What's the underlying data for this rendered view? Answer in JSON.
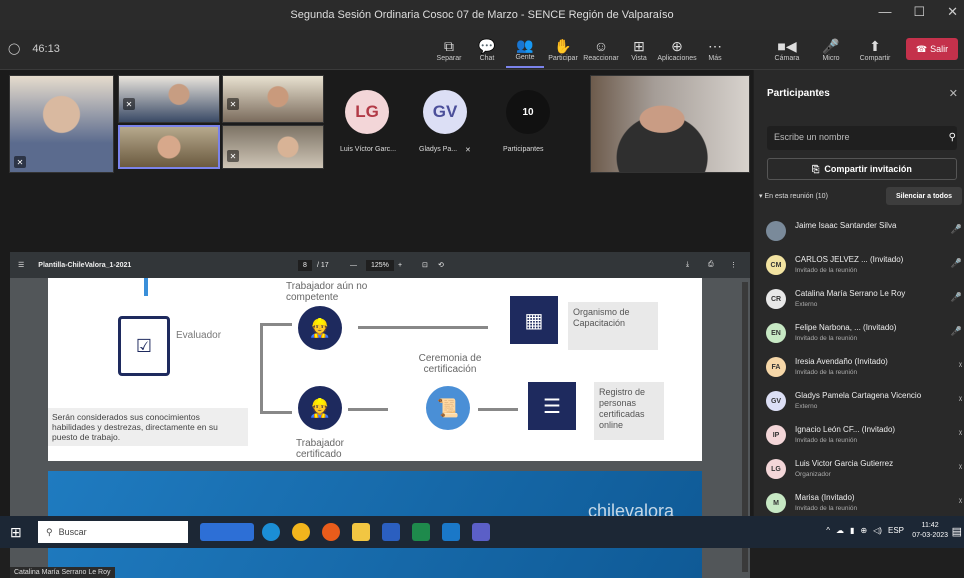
{
  "window": {
    "title": "Segunda Sesión Ordinaria Cosoc 07 de Marzo - SENCE Región de Valparaíso",
    "min": "—",
    "max": "☐",
    "close": "✕"
  },
  "toolbar": {
    "timer": "46:13",
    "items": [
      {
        "label": "Separar",
        "icon": "⧉"
      },
      {
        "label": "Chat",
        "icon": "💬"
      },
      {
        "label": "Gente",
        "icon": "👥"
      },
      {
        "label": "Participar",
        "icon": "✋"
      },
      {
        "label": "Reaccionar",
        "icon": "☺"
      },
      {
        "label": "Vista",
        "icon": "⊞"
      },
      {
        "label": "Aplicaciones",
        "icon": "⊕"
      },
      {
        "label": "Más",
        "icon": "⋯"
      }
    ],
    "right": [
      {
        "label": "Cámara",
        "icon": "■◀"
      },
      {
        "label": "Micro",
        "icon": "🎤"
      },
      {
        "label": "Compartir",
        "icon": "⬆"
      }
    ],
    "leave": "Salir"
  },
  "video": {
    "avatars": [
      {
        "initials": "LG",
        "name": "Luis Víctor Garc...",
        "color": "#f3d6d8",
        "text": "#b23a46"
      },
      {
        "initials": "GV",
        "name": "Gladys Pa...",
        "color": "#dcdff5",
        "text": "#4b4f9a"
      }
    ],
    "count": "10",
    "count_label": "Participantes"
  },
  "pdf": {
    "filename": "Plantilla-ChileValora_1-2021",
    "page": "8",
    "pages": "/ 17",
    "zoom": "125%"
  },
  "slide": {
    "evaluador": "Evaluador",
    "aun": "Trabajador aún no competente",
    "ceremonia": "Ceremonia de certificación",
    "certificado": "Trabajador certificado",
    "organismo": "Organismo de Capacitación",
    "registro": "Registro de personas certificadas online",
    "serán": "Serán considerados sus conocimientos habilidades y destrezas, directamente en su puesto de trabajo.",
    "brand": "chilevalora"
  },
  "speaker": "Catalina María Serrano Le Roy",
  "panel": {
    "title": "Participantes",
    "search": "Escribe un nombre",
    "invite": "Compartir invitación",
    "inmeet": "En esta reunión (10)",
    "muteall": "Silenciar a todos",
    "people": [
      {
        "initials": "",
        "name": "Jaime Isaac Santander Silva",
        "role": "",
        "color": "#7a8a9a"
      },
      {
        "initials": "CM",
        "name": "CARLOS JELVEZ ... (Invitado)",
        "role": "Invitado de la reunión",
        "color": "#f2e3a1"
      },
      {
        "initials": "CR",
        "name": "Catalina María Serrano Le Roy",
        "role": "Externo",
        "color": "#e8e8e8"
      },
      {
        "initials": "EN",
        "name": "Felipe Narbona, ... (Invitado)",
        "role": "Invitado de la reunión",
        "color": "#c7e8c4"
      },
      {
        "initials": "FA",
        "name": "Iresia Avendaño (Invitado)",
        "role": "Invitado de la reunión",
        "color": "#f6d7a8"
      },
      {
        "initials": "GV",
        "name": "Gladys Pamela Cartagena Vicencio",
        "role": "Externo",
        "color": "#dcdff5"
      },
      {
        "initials": "IP",
        "name": "Ignacio León CF... (Invitado)",
        "role": "Invitado de la reunión",
        "color": "#f3d6d8"
      },
      {
        "initials": "LG",
        "name": "Luis Victor Garcia Gutierrez",
        "role": "Organizador",
        "color": "#f3d6d8"
      },
      {
        "initials": "M",
        "name": "Marisa (Invitado)",
        "role": "Invitado de la reunión",
        "color": "#c7e8c4"
      }
    ]
  },
  "taskbar": {
    "search": "Buscar",
    "lang": "ESP",
    "time": "11:42",
    "date": "07-03-2023"
  }
}
